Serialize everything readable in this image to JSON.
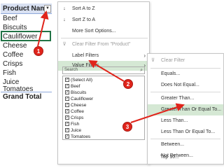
{
  "pivot": {
    "header": "Product Name",
    "dropdown_glyph": "▼",
    "rows": [
      "Beef",
      "Biscuits",
      "Cauliflower",
      "Cheese",
      "Coffee",
      "Crisps",
      "Fish",
      "Juice",
      "Tomatoes"
    ],
    "grand_total": "Grand Total"
  },
  "menu": {
    "sort_az": "Sort A to Z",
    "sort_za": "Sort Z to A",
    "more_sort": "More Sort Options...",
    "clear_filter": "Clear Filter From \"Product\"",
    "label_filters": "Label Filters",
    "value_filters": "Value Filters",
    "search_placeholder": "Search",
    "items": [
      "(Select All)",
      "Beef",
      "Biscuits",
      "Cauliflower",
      "Cheese",
      "Coffee",
      "Crisps",
      "Fish",
      "Juice",
      "Tomatoes"
    ]
  },
  "submenu": {
    "clear_filter": "Clear Filter",
    "items": [
      "Equals...",
      "Does Not Equal...",
      "Greater Than...",
      "Greater Than Or Equal To...",
      "Less Than...",
      "Less Than Or Equal To...",
      "Between...",
      "Not Between...",
      "Top 10..."
    ]
  },
  "badges": [
    "1",
    "2",
    "3"
  ],
  "colors": {
    "highlight": "#d5e8d4",
    "annotation": "#e0241b",
    "header": "#d9e1f2"
  }
}
